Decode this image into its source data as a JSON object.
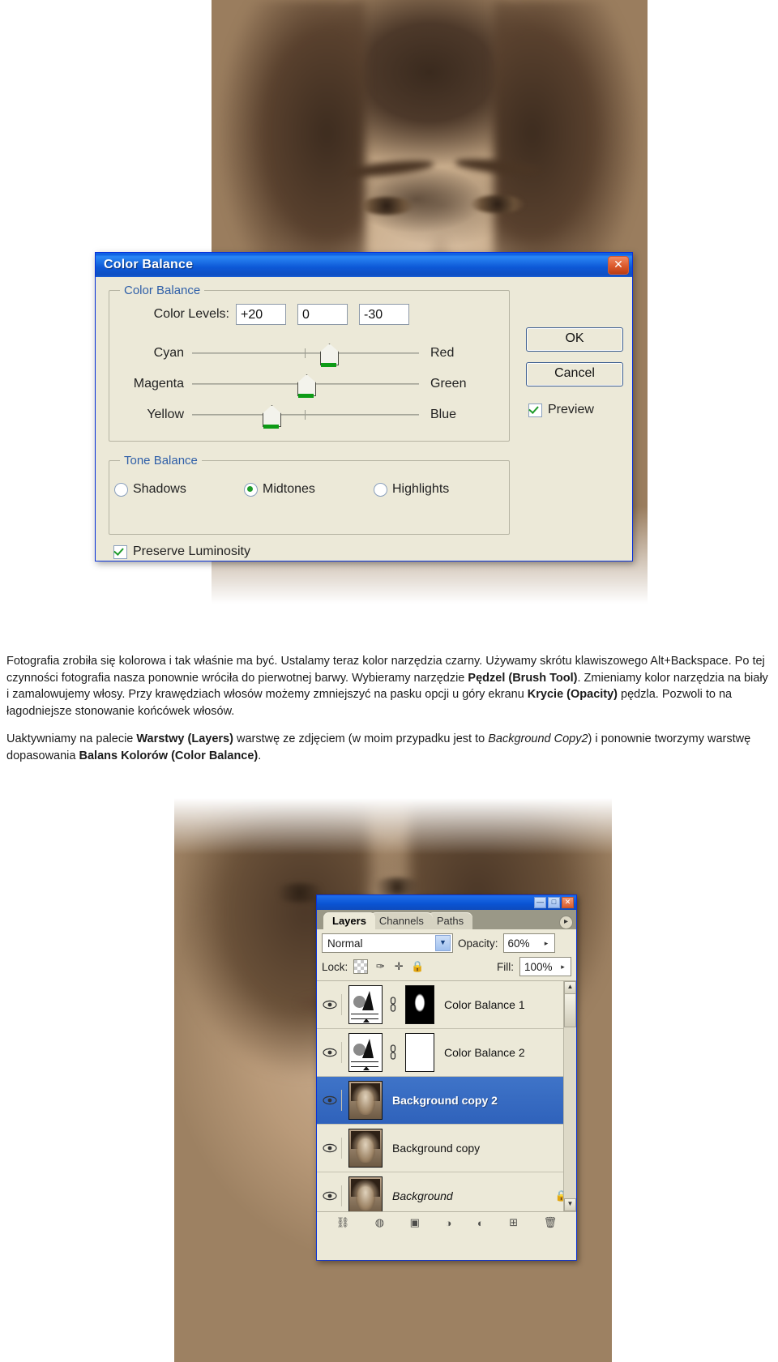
{
  "color_balance_dialog": {
    "title": "Color Balance",
    "close_glyph": "✕",
    "color_group_legend": "Color Balance",
    "color_levels_label": "Color Levels:",
    "levels": [
      "+20",
      "0",
      "-30"
    ],
    "sliders": [
      {
        "left": "Cyan",
        "right": "Red",
        "value": 20
      },
      {
        "left": "Magenta",
        "right": "Green",
        "value": 0
      },
      {
        "left": "Yellow",
        "right": "Blue",
        "value": -30
      }
    ],
    "tone_group_legend": "Tone Balance",
    "tone_options": [
      "Shadows",
      "Midtones",
      "Highlights"
    ],
    "tone_selected": "Midtones",
    "preserve_luminosity_label": "Preserve Luminosity",
    "preserve_luminosity_checked": true,
    "ok_label": "OK",
    "cancel_label": "Cancel",
    "preview_label": "Preview",
    "preview_checked": true
  },
  "body_text": {
    "paragraph1_a": "Fotografia zrobiła się kolorowa i tak właśnie ma być. Ustalamy teraz kolor narzędzia czarny. Używamy skrótu klawiszowego Alt+Backspace. Po tej czynności fotografia nasza ponownie wróciła do pierwotnej barwy. Wybieramy narzędzie ",
    "paragraph1_b1": "Pędzel (Brush Tool)",
    "paragraph1_c": ". Zmieniamy kolor narzędzia na biały i zamalowujemy włosy. Przy krawędziach włosów możemy zmniejszyć na pasku opcji u góry ekranu ",
    "paragraph1_b2": "Krycie (Opacity)",
    "paragraph1_d": " pędzla. Pozwoli to na łagodniejsze stonowanie końcówek włosów.",
    "paragraph2_a": "Uaktywniamy na palecie ",
    "paragraph2_b1": "Warstwy (Layers)",
    "paragraph2_c": " warstwę ze zdjęciem (w moim przypadku jest to ",
    "paragraph2_i": "Background Copy2",
    "paragraph2_d": ") i ponownie tworzymy warstwę dopasowania ",
    "paragraph2_b2": "Balans Kolorów (Color Balance)",
    "paragraph2_e": "."
  },
  "layers_palette": {
    "minimize_glyph": "—",
    "maximize_glyph": "□",
    "close_glyph": "✕",
    "menu_arrow": "▸",
    "tabs": [
      "Layers",
      "Channels",
      "Paths"
    ],
    "active_tab": "Layers",
    "blend_mode": "Normal",
    "opacity_label": "Opacity:",
    "opacity_value": "60%",
    "lock_label": "Lock:",
    "lock_icons": [
      "transparency-checker",
      "brush",
      "move",
      "lock"
    ],
    "fill_label": "Fill:",
    "fill_value": "100%",
    "layers": [
      {
        "name": "Color Balance 1",
        "thumb": "adjustment",
        "mask": "black",
        "selected": false,
        "locked": false
      },
      {
        "name": "Color Balance 2",
        "thumb": "adjustment",
        "mask": "white",
        "selected": false,
        "locked": false
      },
      {
        "name": "Background copy 2",
        "thumb": "photo",
        "mask": "none",
        "selected": true,
        "locked": false
      },
      {
        "name": "Background copy",
        "thumb": "photo",
        "mask": "none",
        "selected": false,
        "locked": false
      },
      {
        "name": "Background",
        "thumb": "photo",
        "mask": "none",
        "selected": false,
        "locked": true
      }
    ],
    "lock_glyph": "🔒",
    "footer_icons": [
      "link",
      "styles",
      "mask",
      "group",
      "adjustment",
      "new-layer",
      "delete"
    ],
    "scroll_up": "▲",
    "scroll_down": "▼"
  }
}
